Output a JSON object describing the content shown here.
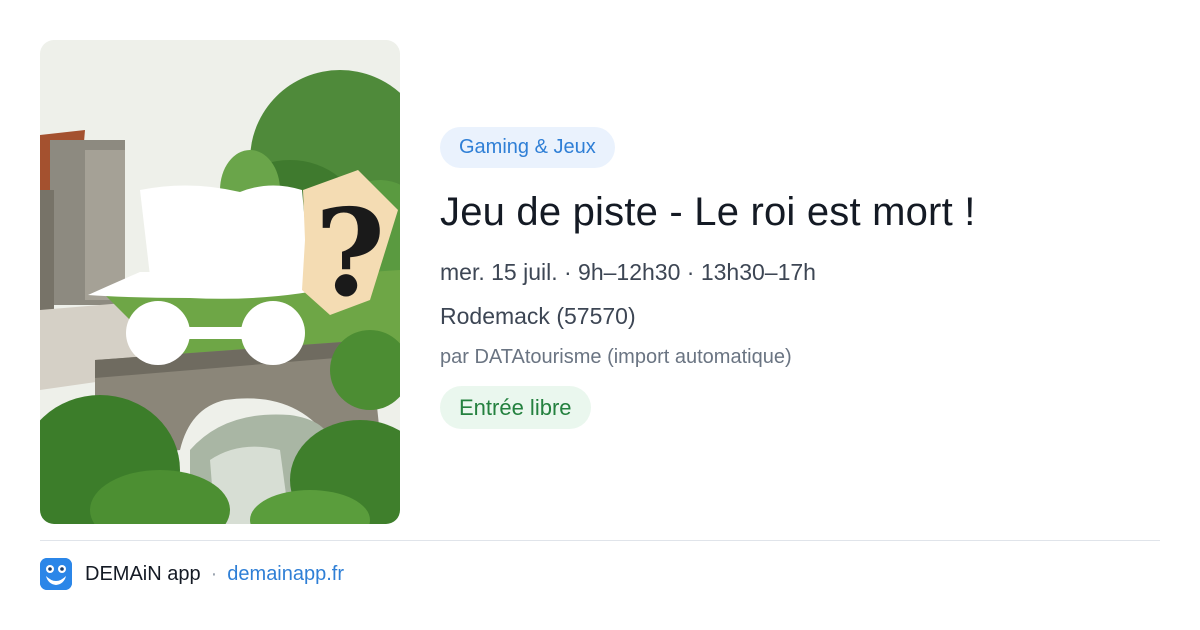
{
  "event": {
    "image_alt": "Pont de pierre à Rodemack avec lunettes et chapeau",
    "image_icon": "mystery-detective-icon",
    "category": "Gaming & Jeux",
    "title": "Jeu de piste - Le roi est mort !",
    "datetime": "mer. 15 juil. · 9h–12h30 · 13h30–17h",
    "location": "Rodemack (57570)",
    "organizer": "par DATAtourisme (import automatique)",
    "price": "Entrée libre"
  },
  "footer": {
    "app_name": "DEMAiN app",
    "separator": "·",
    "link": "demainapp.fr"
  },
  "colors": {
    "category_badge_bg": "#eaf2fd",
    "category_badge_text": "#2f7fd6",
    "price_badge_bg": "#eaf7ee",
    "price_badge_text": "#24813f",
    "link": "#2f7fd6",
    "logo": "#2b86e8"
  }
}
